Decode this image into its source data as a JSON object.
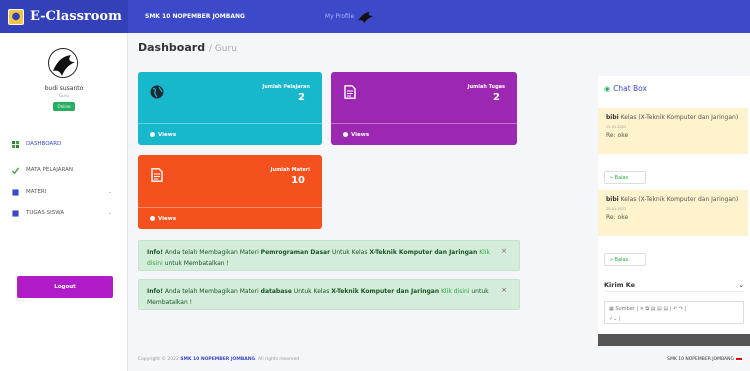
{
  "header": {
    "brand": "E-Classroom",
    "school": "SMK 10 NOPEMBER JOMBANG",
    "profile_link": "My Profile"
  },
  "sidebar": {
    "user_name": "budi susanto",
    "user_role": "Guru",
    "status": "Online",
    "items": [
      {
        "label": "DASHBOARD"
      },
      {
        "label": "MATA PELAJARAN"
      },
      {
        "label": "MATERI"
      },
      {
        "label": "TUGAS SISWA"
      }
    ],
    "logout": "Logout"
  },
  "page": {
    "title": "Dashboard",
    "subtitle": "/ Guru"
  },
  "cards": [
    {
      "title": "Jumlah Pelajaran",
      "value": "2",
      "footer": "Views",
      "color": "#17b7cc"
    },
    {
      "title": "Jumlah Tugas",
      "value": "2",
      "footer": "Views",
      "color": "#9c27b0"
    },
    {
      "title": "Jumlah Materi",
      "value": "10",
      "footer": "Views",
      "color": "#f4511e"
    }
  ],
  "alerts": [
    {
      "p1": "Info!",
      "p2": " Anda telah Membagikan Materi ",
      "p3": "Pemrograman Dasar",
      "p4": " Untuk Kelas ",
      "p5": "X-Teknik Komputer dan Jaringan",
      "p6": "Klik disini",
      "p7": " untuk Membatalkan !"
    },
    {
      "p1": "Info!",
      "p2": " Anda telah Membagikan Materi ",
      "p3": "database",
      "p4": " Untuk Kelas ",
      "p5": "X-Teknik Komputer dan Jaringan",
      "p6": "Klik disini",
      "p7": " untuk Membatalkan !"
    }
  ],
  "chat": {
    "title": "Chat Box",
    "messages": [
      {
        "sender": "bibi",
        "kelas": "Kelas",
        "class": "(X-Teknik Komputer dan Jaringan)",
        "date": "25-01-2022",
        "reply": "Re: oke"
      },
      {
        "sender": "bibi",
        "kelas": "Kelas",
        "class": "(X-Teknik Komputer dan Jaringan)",
        "date": "25-01-2022",
        "reply": "Re: oke"
      }
    ],
    "reply_label": "» Balas",
    "send_to_label": "Kirim Ke",
    "editor_source": "Sumber"
  },
  "footer": {
    "pre": "Copyright © 2022 ",
    "brand": "SMK 10 NOPEMBER JOMBANG",
    "post": ". All rights reserved",
    "right": "SMK 10 NOPEMBER JOMBANG"
  }
}
